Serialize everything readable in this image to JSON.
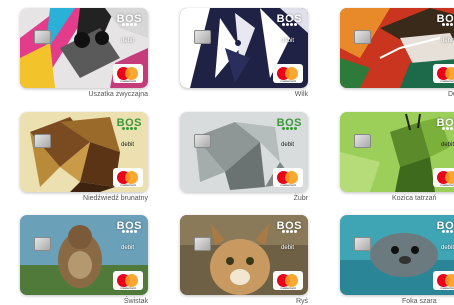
{
  "gallery": {
    "cards": [
      {
        "caption": "Uszatka zwyczajna",
        "logo": "BOS",
        "type": "debit",
        "network": "mastercard"
      },
      {
        "caption": "Wilk",
        "logo": "BOS",
        "type": "debit",
        "network": "mastercard"
      },
      {
        "caption": "Du",
        "logo": "BOS",
        "type": "debit",
        "network": "mastercard"
      },
      {
        "caption": "Niedźwiedź brunatny",
        "logo": "BOS",
        "type": "debit",
        "network": "mastercard"
      },
      {
        "caption": "Żubr",
        "logo": "BOS",
        "type": "debit",
        "network": "mastercard"
      },
      {
        "caption": "Kozica tatrzań",
        "logo": "BOS",
        "type": "debit",
        "network": "mastercard"
      },
      {
        "caption": "Świstak",
        "logo": "BOS",
        "type": "debit",
        "network": "mastercard"
      },
      {
        "caption": "Ryś",
        "logo": "BOS",
        "type": "debit",
        "network": "mastercard"
      },
      {
        "caption": "Foka szara",
        "logo": "BOS",
        "type": "debit",
        "network": "mastercard"
      }
    ]
  },
  "colors": {
    "brand_green": "#3a9a3a",
    "mastercard_red": "#eb001b",
    "mastercard_orange": "#f79e1b"
  },
  "icons": [
    "bos-logo",
    "chip-icon",
    "mastercard-icon"
  ]
}
